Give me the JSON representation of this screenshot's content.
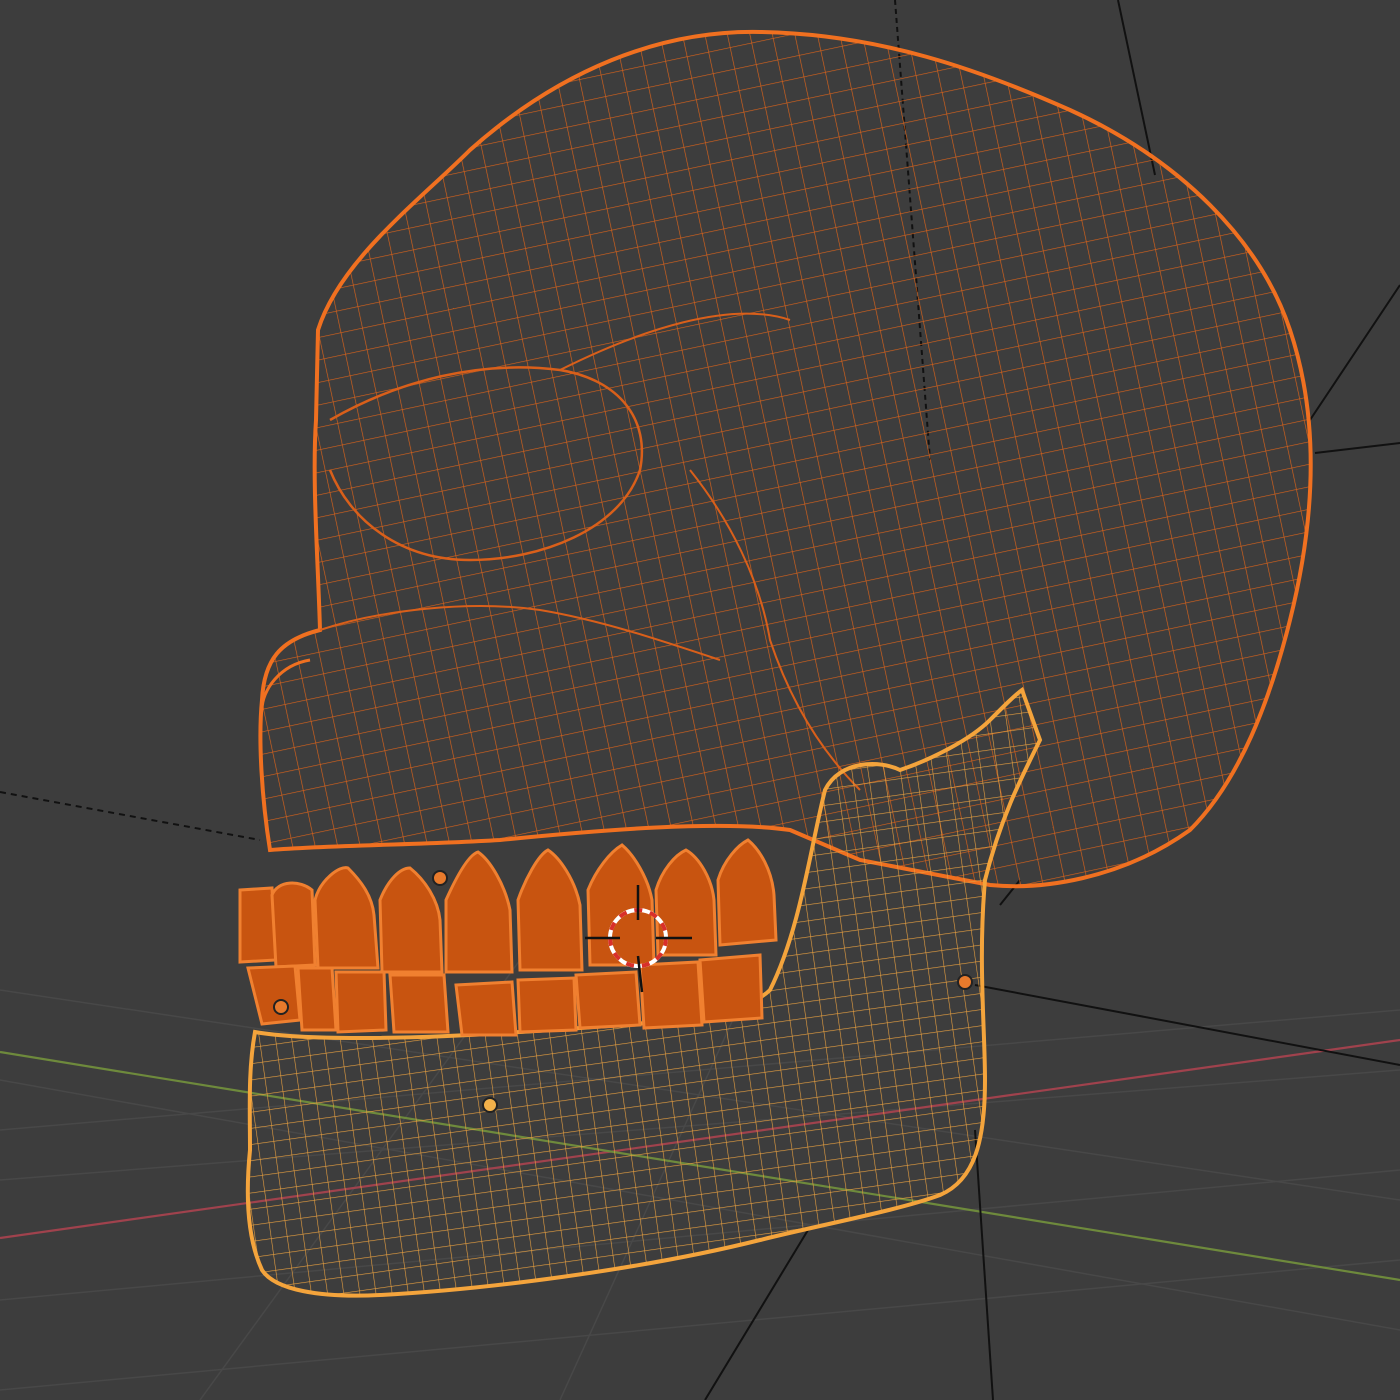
{
  "viewport": {
    "mode": "wireframe",
    "background_color": "#3d3d3d",
    "grid_color": "#4a4a4a",
    "x_axis_color": "#a0424d",
    "y_axis_color": "#6e8a3c"
  },
  "objects": [
    {
      "name": "skull-cranium",
      "selected": true,
      "active": false,
      "wire_color": "#e56a1a"
    },
    {
      "name": "jaw",
      "selected": true,
      "active": true,
      "wire_color": "#f2a33a"
    },
    {
      "name": "upper-teeth",
      "selected": true,
      "active": false,
      "wire_color": "#e56a1a"
    },
    {
      "name": "lower-teeth",
      "selected": true,
      "active": false,
      "wire_color": "#e56a1a"
    }
  ],
  "overlays": {
    "origin_dot_color": "#e87a2c",
    "active_origin_dot_color": "#f2b14a",
    "cursor_ring_colors": [
      "#d9302a",
      "#ffffff"
    ],
    "relationship_line_color": "#111111"
  }
}
